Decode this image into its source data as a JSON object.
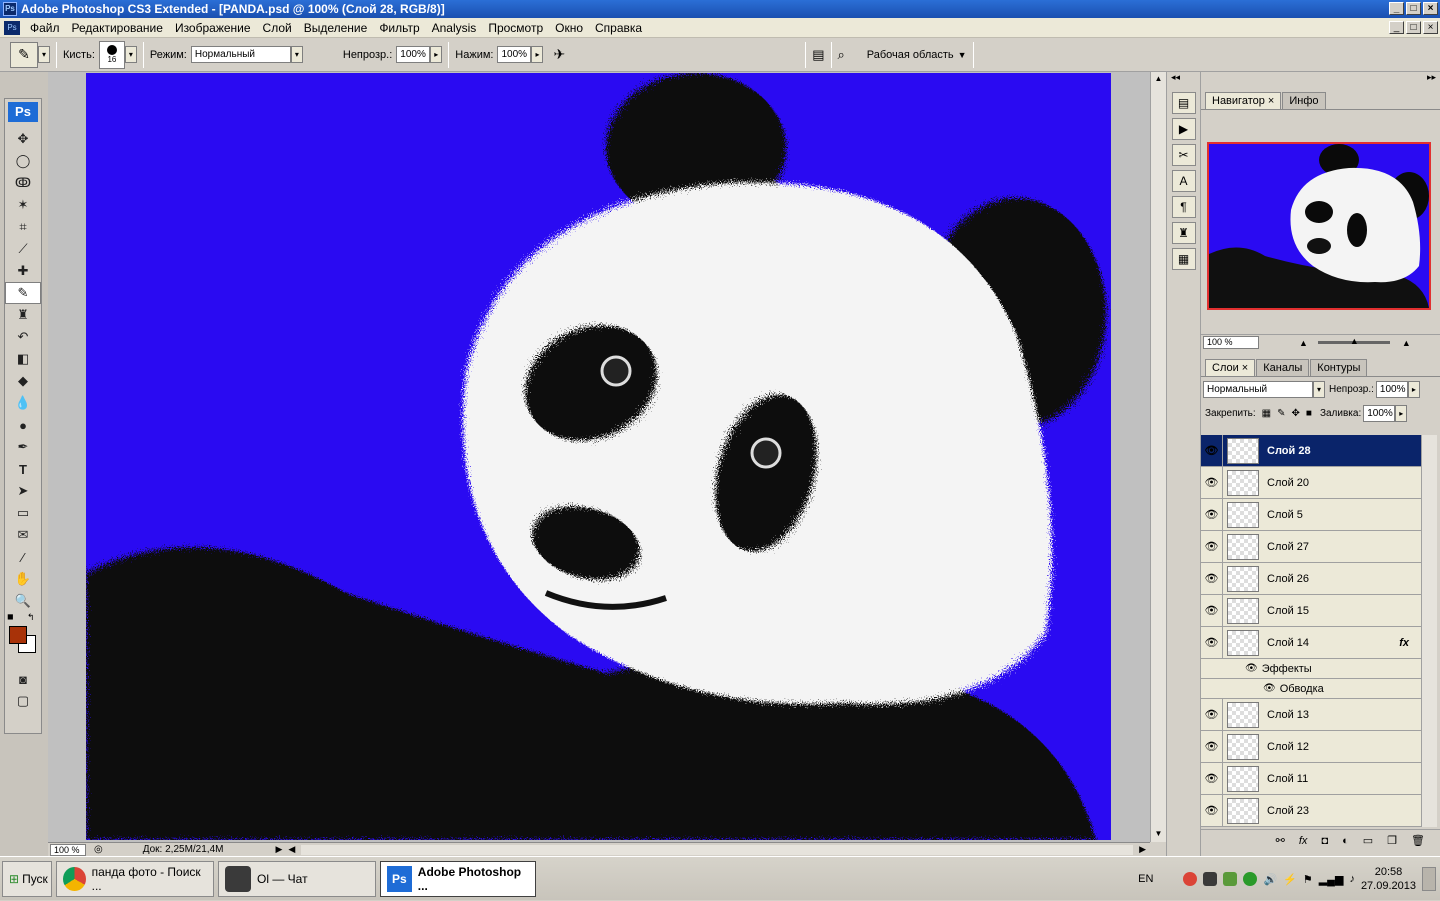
{
  "window": {
    "title": "Adobe Photoshop CS3 Extended - [PANDA.psd @ 100% (Слой 28, RGB/8)]",
    "app_icon": "Ps"
  },
  "menu": [
    "Файл",
    "Редактирование",
    "Изображение",
    "Слой",
    "Выделение",
    "Фильтр",
    "Analysis",
    "Просмотр",
    "Окно",
    "Справка"
  ],
  "options": {
    "brush_label": "Кисть:",
    "brush_size": "16",
    "mode_label": "Режим:",
    "mode_value": "Нормальный",
    "opacity_label": "Непрозр.:",
    "opacity_value": "100%",
    "flow_label": "Нажим:",
    "flow_value": "100%",
    "workspace_label": "Рабочая область"
  },
  "toolbox": {
    "logo": "Ps",
    "foreground_color": "#a83208",
    "background_color": "#ffffff"
  },
  "canvas": {
    "background_color": "#2a0af2"
  },
  "status": {
    "zoom": "100 %",
    "doc_info": "Док: 2,25M/21,4M"
  },
  "navigator": {
    "tabs": [
      "Навигатор",
      "Инфо"
    ],
    "zoom": "100 %"
  },
  "layers_panel": {
    "tabs": [
      "Слои",
      "Каналы",
      "Контуры"
    ],
    "blend_mode": "Нормальный",
    "opacity_label": "Непрозр.:",
    "opacity_value": "100%",
    "lock_label": "Закрепить:",
    "fill_label": "Заливка:",
    "fill_value": "100%",
    "layers": [
      {
        "name": "Слой 28",
        "selected": true
      },
      {
        "name": "Слой 20"
      },
      {
        "name": "Слой 5"
      },
      {
        "name": "Слой 27"
      },
      {
        "name": "Слой 26"
      },
      {
        "name": "Слой 15"
      },
      {
        "name": "Слой 14",
        "fx": "fx"
      },
      {
        "name": "Слой 13"
      },
      {
        "name": "Слой 12"
      },
      {
        "name": "Слой 11"
      },
      {
        "name": "Слой 23"
      }
    ],
    "effects_label": "Эффекты",
    "stroke_label": "Обводка"
  },
  "taskbar": {
    "start": "Пуск",
    "buttons": [
      "панда фото - Поиск ...",
      "Ol — Чат",
      "Adobe Photoshop ..."
    ],
    "lang": "EN",
    "time": "20:58",
    "date": "27.09.2013"
  }
}
